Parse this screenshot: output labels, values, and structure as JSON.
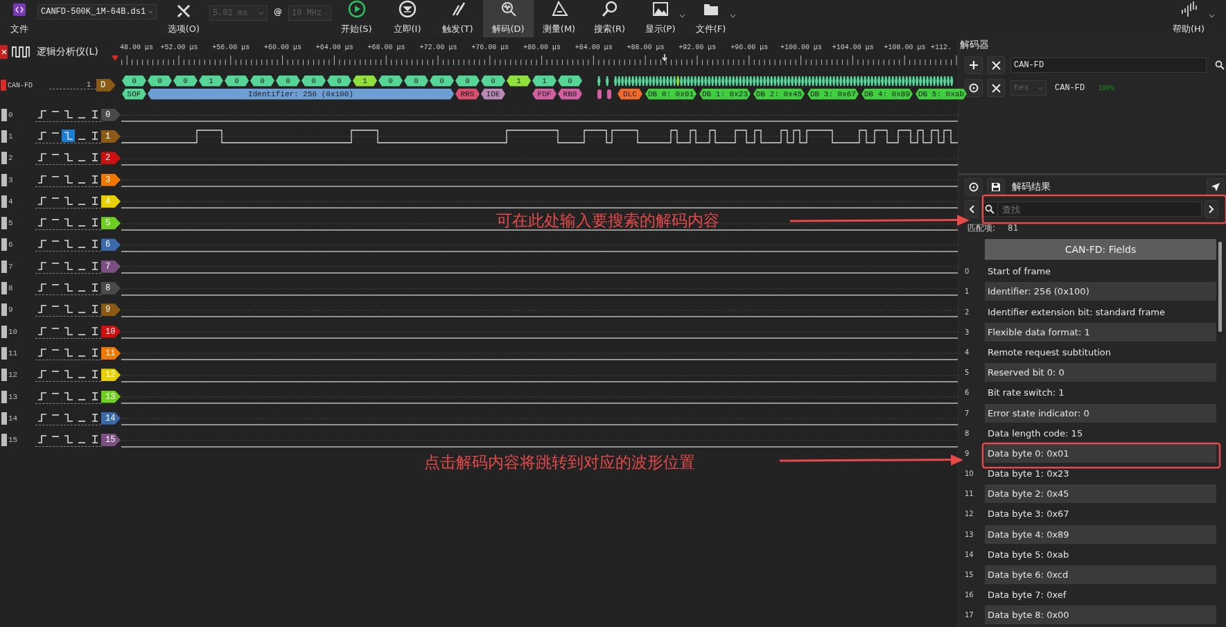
{
  "toolbar": {
    "file": {
      "label": "文件"
    },
    "file_select": {
      "value": "CANFD-500K_1M-64B.ds1"
    },
    "options": {
      "label": "选项(O)"
    },
    "duration": {
      "value": "5.02 ms",
      "disabled": true
    },
    "at": "@",
    "rate": {
      "value": "10 MHz",
      "disabled": true
    },
    "tools": [
      {
        "kind": "start",
        "label": "开始(S)",
        "selected": false,
        "has_menu": false
      },
      {
        "kind": "instant",
        "label": "立即(I)",
        "selected": false,
        "has_menu": false
      },
      {
        "kind": "trigger",
        "label": "触发(T)",
        "selected": false,
        "has_menu": false
      },
      {
        "kind": "decode",
        "label": "解码(D)",
        "selected": true,
        "has_menu": false
      },
      {
        "kind": "measure",
        "label": "测量(M)",
        "selected": false,
        "has_menu": false
      },
      {
        "kind": "search",
        "label": "搜索(R)",
        "selected": false,
        "has_menu": false
      },
      {
        "kind": "display",
        "label": "显示(P)",
        "selected": false,
        "has_menu": true
      },
      {
        "kind": "file",
        "label": "文件(F)",
        "selected": false,
        "has_menu": true
      }
    ],
    "help": {
      "label": "帮助(H)",
      "has_menu": true
    }
  },
  "timeline": {
    "title": "逻辑分析仪(L)",
    "ticks": [
      "48.00 μs",
      "+52.00 μs",
      "+56.00 μs",
      "+60.00 μs",
      "+64.00 μs",
      "+68.00 μs",
      "+72.00 μs",
      "+76.00 μs",
      "+80.00 μs",
      "+84.00 μs",
      "+88.00 μs",
      "+92.00 μs",
      "+96.00 μs",
      "+100.00 μs",
      "+104.00 μs",
      "+108.00 μs",
      "+112."
    ]
  },
  "decoder_row": {
    "color": "#e02828",
    "name": "CAN-FD",
    "count": "1",
    "tag": {
      "text": "D",
      "color": "#8b5a14"
    },
    "bits": [
      {
        "text": "0",
        "color": "#55d596"
      },
      {
        "text": "0",
        "color": "#55d596"
      },
      {
        "text": "0",
        "color": "#55d596"
      },
      {
        "text": "1",
        "color": "#55d596"
      },
      {
        "text": "0",
        "color": "#55d596"
      },
      {
        "text": "0",
        "color": "#55d596"
      },
      {
        "text": "0",
        "color": "#55d596"
      },
      {
        "text": "0",
        "color": "#55d596"
      },
      {
        "text": "0",
        "color": "#55d596"
      },
      {
        "text": "1",
        "color": "#8fe03a"
      },
      {
        "text": "0",
        "color": "#55d596"
      },
      {
        "text": "0",
        "color": "#55d596"
      },
      {
        "text": "0",
        "color": "#55d596"
      },
      {
        "text": "0",
        "color": "#55d596"
      },
      {
        "text": "0",
        "color": "#55d596"
      },
      {
        "text": "1",
        "color": "#8fe03a"
      },
      {
        "text": "1",
        "color": "#55d596"
      },
      {
        "text": "0",
        "color": "#55d596"
      }
    ],
    "fields": [
      {
        "text": "SOF",
        "color": "#55d596"
      },
      {
        "text": "Identifier: 256 (0x100)",
        "color": "#6e9fd4"
      },
      {
        "text": "RRS",
        "color": "#d8506e"
      },
      {
        "text": "IDE",
        "color": "#b88ab8"
      },
      {
        "text": "FDF",
        "color": "#d060a0"
      },
      {
        "text": "RB0",
        "color": "#d060a0"
      },
      {
        "color": "#d060a0"
      },
      {
        "color": "#d060a0"
      },
      {
        "text": "DLC",
        "color": "#f06a2a"
      },
      {
        "text": "DB 0: 0x01",
        "color": "#3fcf3f"
      },
      {
        "text": "DB 1: 0x23",
        "color": "#3fcf3f"
      },
      {
        "text": "DB 2: 0x45",
        "color": "#3fcf3f"
      },
      {
        "text": "DB 3: 0x67",
        "color": "#3fcf3f"
      },
      {
        "text": "DB 4: 0x89",
        "color": "#3fcf3f"
      },
      {
        "text": "DB 5: 0xab",
        "color": "#3fcf3f"
      }
    ]
  },
  "channels": [
    {
      "label": "0",
      "triggers": [
        {
          "selected": false
        },
        {
          "selected": false
        },
        {
          "selected": false
        },
        {
          "selected": false
        },
        {
          "selected": false
        }
      ],
      "tag": "0",
      "color": "#4a4a4a",
      "kind": "flat"
    },
    {
      "label": "1",
      "triggers": [
        {
          "selected": false
        },
        {
          "selected": false
        },
        {
          "selected": true
        },
        {
          "selected": false
        },
        {
          "selected": false
        }
      ],
      "tag": "1",
      "color": "#8b5a14",
      "kind": "pulses"
    },
    {
      "label": "2",
      "triggers": [
        {
          "selected": false
        },
        {
          "selected": false
        },
        {
          "selected": false
        },
        {
          "selected": false
        },
        {
          "selected": false
        }
      ],
      "tag": "2",
      "color": "#cc1010",
      "kind": "flat"
    },
    {
      "label": "3",
      "triggers": [
        {
          "selected": false
        },
        {
          "selected": false
        },
        {
          "selected": false
        },
        {
          "selected": false
        },
        {
          "selected": false
        }
      ],
      "tag": "3",
      "color": "#f07800",
      "kind": "flat"
    },
    {
      "label": "4",
      "triggers": [
        {
          "selected": false
        },
        {
          "selected": false
        },
        {
          "selected": false
        },
        {
          "selected": false
        },
        {
          "selected": false
        }
      ],
      "tag": "4",
      "color": "#e8d000",
      "kind": "flat"
    },
    {
      "label": "5",
      "triggers": [
        {
          "selected": false
        },
        {
          "selected": false
        },
        {
          "selected": false
        },
        {
          "selected": false
        },
        {
          "selected": false
        }
      ],
      "tag": "5",
      "color": "#6fcf20",
      "kind": "flat"
    },
    {
      "label": "6",
      "triggers": [
        {
          "selected": false
        },
        {
          "selected": false
        },
        {
          "selected": false
        },
        {
          "selected": false
        },
        {
          "selected": false
        }
      ],
      "tag": "6",
      "color": "#3a6aaa",
      "kind": "flat"
    },
    {
      "label": "7",
      "triggers": [
        {
          "selected": false
        },
        {
          "selected": false
        },
        {
          "selected": false
        },
        {
          "selected": false
        },
        {
          "selected": false
        }
      ],
      "tag": "7",
      "color": "#7a5080",
      "kind": "flat"
    },
    {
      "label": "8",
      "triggers": [
        {
          "selected": false
        },
        {
          "selected": false
        },
        {
          "selected": false
        },
        {
          "selected": false
        },
        {
          "selected": false
        }
      ],
      "tag": "8",
      "color": "#4a4a4a",
      "kind": "flat"
    },
    {
      "label": "9",
      "triggers": [
        {
          "selected": false
        },
        {
          "selected": false
        },
        {
          "selected": false
        },
        {
          "selected": false
        },
        {
          "selected": false
        }
      ],
      "tag": "9",
      "color": "#8b5a14",
      "kind": "flat"
    },
    {
      "label": "10",
      "triggers": [
        {
          "selected": false
        },
        {
          "selected": false
        },
        {
          "selected": false
        },
        {
          "selected": false
        },
        {
          "selected": false
        }
      ],
      "tag": "10",
      "color": "#cc1010",
      "kind": "flat"
    },
    {
      "label": "11",
      "triggers": [
        {
          "selected": false
        },
        {
          "selected": false
        },
        {
          "selected": false
        },
        {
          "selected": false
        },
        {
          "selected": false
        }
      ],
      "tag": "11",
      "color": "#f07800",
      "kind": "flat"
    },
    {
      "label": "12",
      "triggers": [
        {
          "selected": false
        },
        {
          "selected": false
        },
        {
          "selected": false
        },
        {
          "selected": false
        },
        {
          "selected": false
        }
      ],
      "tag": "12",
      "color": "#e8d000",
      "kind": "flat"
    },
    {
      "label": "13",
      "triggers": [
        {
          "selected": false
        },
        {
          "selected": false
        },
        {
          "selected": false
        },
        {
          "selected": false
        },
        {
          "selected": false
        }
      ],
      "tag": "13",
      "color": "#6fcf20",
      "kind": "flat"
    },
    {
      "label": "14",
      "triggers": [
        {
          "selected": false
        },
        {
          "selected": false
        },
        {
          "selected": false
        },
        {
          "selected": false
        },
        {
          "selected": false
        }
      ],
      "tag": "14",
      "color": "#3a6aaa",
      "kind": "flat"
    },
    {
      "label": "15",
      "triggers": [
        {
          "selected": false
        },
        {
          "selected": false
        },
        {
          "selected": false
        },
        {
          "selected": false
        },
        {
          "selected": false
        }
      ],
      "tag": "15",
      "color": "#7a5080",
      "kind": "flat"
    }
  ],
  "decoder_panel": {
    "title": "解码器",
    "search_value": "CAN-FD",
    "format": {
      "value": "hex",
      "disabled": true
    },
    "decoder_name": "CAN-FD",
    "progress": "100%"
  },
  "results": {
    "title": "解码结果",
    "search_placeholder": "查找",
    "match_label": "匹配项:",
    "match_count": "81",
    "header": "CAN-FD: Fields",
    "rows": [
      {
        "index": "0",
        "text": "Start of frame"
      },
      {
        "index": "1",
        "text": "Identifier: 256 (0x100)"
      },
      {
        "index": "2",
        "text": "Identifier extension bit: standard frame"
      },
      {
        "index": "3",
        "text": "Flexible data format: 1"
      },
      {
        "index": "4",
        "text": "Remote request subtitution"
      },
      {
        "index": "5",
        "text": "Reserved bit 0: 0"
      },
      {
        "index": "6",
        "text": "Bit rate switch: 1"
      },
      {
        "index": "7",
        "text": "Error state indicator: 0"
      },
      {
        "index": "8",
        "text": "Data length code: 15"
      },
      {
        "index": "9",
        "text": "Data byte 0: 0x01"
      },
      {
        "index": "10",
        "text": "Data byte 1: 0x23"
      },
      {
        "index": "11",
        "text": "Data byte 2: 0x45"
      },
      {
        "index": "12",
        "text": "Data byte 3: 0x67"
      },
      {
        "index": "13",
        "text": "Data byte 4: 0x89"
      },
      {
        "index": "14",
        "text": "Data byte 5: 0xab"
      },
      {
        "index": "15",
        "text": "Data byte 6: 0xcd"
      },
      {
        "index": "16",
        "text": "Data byte 7: 0xef"
      },
      {
        "index": "17",
        "text": "Data byte 8: 0x00"
      }
    ]
  },
  "annotations": [
    {
      "text": "可在此处输入要搜索的解码内容"
    },
    {
      "text": "点击解码内容将跳转到对应的波形位置"
    }
  ]
}
